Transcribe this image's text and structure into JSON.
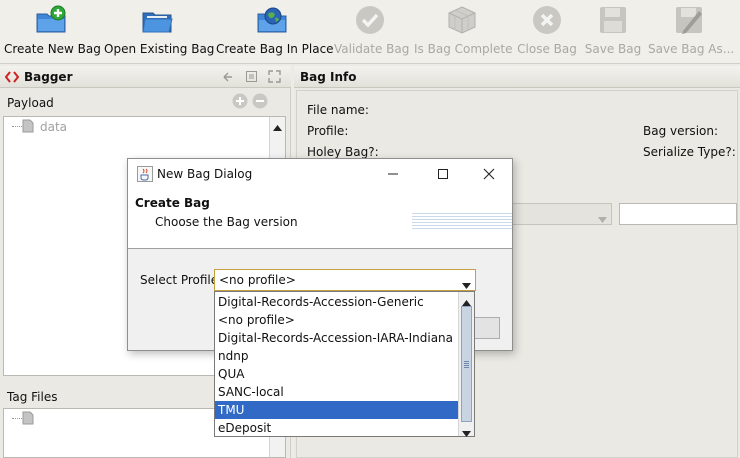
{
  "toolbar": {
    "buttons": [
      {
        "label": "Create New Bag",
        "icon": "folder-add-icon",
        "enabled": true
      },
      {
        "label": "Open Existing Bag",
        "icon": "folder-open-icon",
        "enabled": true
      },
      {
        "label": "Create Bag In Place",
        "icon": "folder-globe-icon",
        "enabled": true
      },
      {
        "label": "Validate Bag",
        "icon": "check-circle-icon",
        "enabled": false
      },
      {
        "label": "Is Bag Complete",
        "icon": "cube-icon",
        "enabled": false
      },
      {
        "label": "Close Bag",
        "icon": "close-circle-icon",
        "enabled": false
      },
      {
        "label": "Save Bag",
        "icon": "floppy-icon",
        "enabled": false
      },
      {
        "label": "Save Bag As...",
        "icon": "floppy-pencil-icon",
        "enabled": false
      }
    ]
  },
  "left_panel": {
    "title": "Bagger",
    "payload_label": "Payload",
    "payload_tree": [
      "data"
    ],
    "tag_files_label": "Tag Files"
  },
  "right_panel": {
    "title": "Bag Info",
    "file_name_label": "File name:",
    "profile_label": "Profile:",
    "holey_label": "Holey Bag?:",
    "bag_version_label": "Bag version:",
    "serialize_label": "Serialize Type?:"
  },
  "dialog": {
    "title": "New Bag Dialog",
    "heading": "Create Bag",
    "subheading": "Choose the Bag version",
    "select_profile_label": "Select Profile:",
    "selected_profile": "<no profile>",
    "options": [
      "Digital-Records-Accession-Generic",
      "<no profile>",
      "Digital-Records-Accession-IARA-Indiana",
      "ndnp",
      "QUA",
      "SANC-local",
      "TMU",
      "eDeposit"
    ],
    "highlighted_option": "TMU"
  },
  "colors": {
    "selection": "#3069c6",
    "disabled_text": "#a9a8a2",
    "window_bg": "#ecebe5"
  }
}
